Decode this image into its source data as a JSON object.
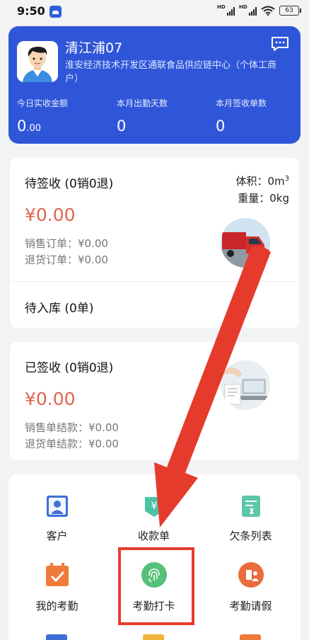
{
  "status_bar": {
    "time": "9:50",
    "signal1": "HD",
    "signal2": "HD",
    "battery": "63"
  },
  "profile": {
    "name": "清江浦07",
    "org": "淮安经济技术开发区通联食品供应链中心（个体工商户）",
    "stats": [
      {
        "label": "今日实收金额",
        "value_main": "0",
        "value_decimal": ".00"
      },
      {
        "label": "本月出勤天数",
        "value_main": "0",
        "value_decimal": ""
      },
      {
        "label": "本月签收单数",
        "value_main": "0",
        "value_decimal": ""
      }
    ]
  },
  "pending_card": {
    "title": "待签收 (0销0退)",
    "amount": "¥0.00",
    "sales_order": "销售订单：¥0.00",
    "return_order": "退货订单：¥0.00",
    "volume_label": "体积：0m",
    "volume_sup": "3",
    "weight": "重量：0kg",
    "storage": "待入库 (0单)",
    "image_icon": "truck-photo"
  },
  "signed_card": {
    "title": "已签收 (0销0退)",
    "amount": "¥0.00",
    "sales_settle": "销售单结款：¥0.00",
    "return_settle": "退货单结款：¥0.00",
    "image_icon": "laptop-photo"
  },
  "menu": [
    {
      "label": "客户",
      "icon": "customer-icon"
    },
    {
      "label": "收款单",
      "icon": "receipt-icon"
    },
    {
      "label": "欠条列表",
      "icon": "iou-list-icon"
    },
    {
      "label": "我的考勤",
      "icon": "calendar-check-icon"
    },
    {
      "label": "考勤打卡",
      "icon": "fingerprint-icon"
    },
    {
      "label": "考勤请假",
      "icon": "leave-icon"
    }
  ],
  "colors": {
    "brand": "#2f56d8",
    "amount": "#e0654a",
    "annotation": "#e53b2c"
  }
}
